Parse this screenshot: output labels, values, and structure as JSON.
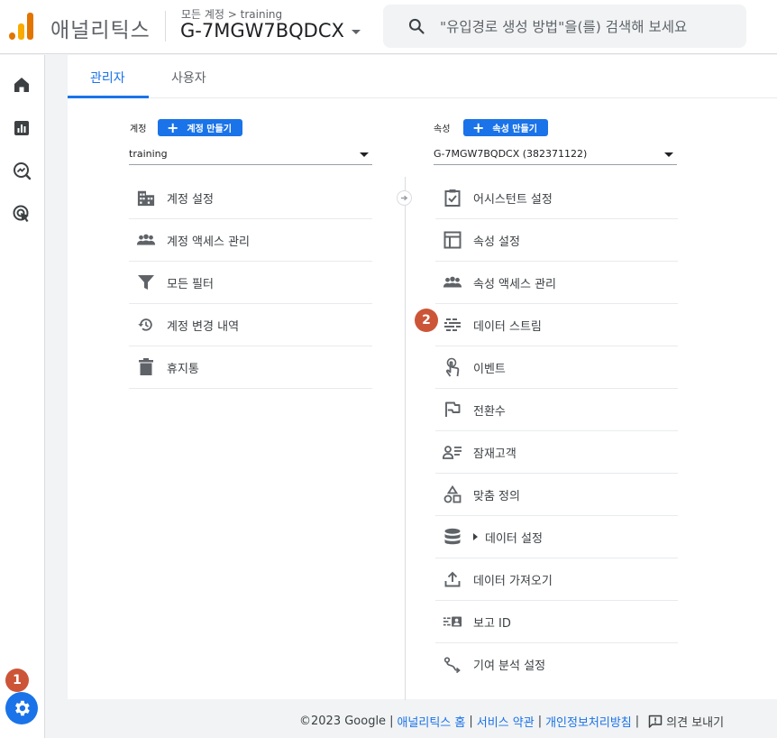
{
  "header": {
    "app_name": "애널리틱스",
    "breadcrumb": "모든 계정 > training",
    "property_name": "G-7MGW7BQDCX",
    "search_placeholder": "\"유입경로 생성 방법\"을(를) 검색해 보세요"
  },
  "tabs": [
    {
      "label": "관리자",
      "active": true
    },
    {
      "label": "사용자",
      "active": false
    }
  ],
  "account_column": {
    "label": "계정",
    "create_button": "계정 만들기",
    "selected": "training",
    "items": [
      {
        "label": "계정 설정",
        "icon": "building-icon"
      },
      {
        "label": "계정 액세스 관리",
        "icon": "people-icon"
      },
      {
        "label": "모든 필터",
        "icon": "filter-icon"
      },
      {
        "label": "계정 변경 내역",
        "icon": "history-icon"
      },
      {
        "label": "휴지통",
        "icon": "trash-icon"
      }
    ]
  },
  "property_column": {
    "label": "속성",
    "create_button": "속성 만들기",
    "selected": "G-7MGW7BQDCX (382371122)",
    "items": [
      {
        "label": "어시스턴트 설정",
        "icon": "checklist-icon"
      },
      {
        "label": "속성 설정",
        "icon": "layout-icon"
      },
      {
        "label": "속성 액세스 관리",
        "icon": "people-icon"
      },
      {
        "label": "데이터 스트림",
        "icon": "stream-icon"
      },
      {
        "label": "이벤트",
        "icon": "touch-icon"
      },
      {
        "label": "전환수",
        "icon": "flag-icon"
      },
      {
        "label": "잠재고객",
        "icon": "audience-icon"
      },
      {
        "label": "맞춤 정의",
        "icon": "shapes-icon"
      },
      {
        "label": "데이터 설정",
        "icon": "database-icon"
      },
      {
        "label": "데이터 가져오기",
        "icon": "upload-icon"
      },
      {
        "label": "보고 ID",
        "icon": "report-id-icon"
      },
      {
        "label": "기여 분석 설정",
        "icon": "attribution-icon"
      }
    ]
  },
  "badges": {
    "one": "1",
    "two": "2"
  },
  "footer": {
    "copyright": "©2023 Google",
    "links": [
      "애널리틱스 홈",
      "서비스 약관",
      "개인정보처리방침"
    ],
    "feedback": "의견 보내기"
  },
  "colors": {
    "accent": "#1a73e8",
    "badge": "#cc5538",
    "logo_dark": "#e37400",
    "logo_light": "#f9ab00"
  }
}
